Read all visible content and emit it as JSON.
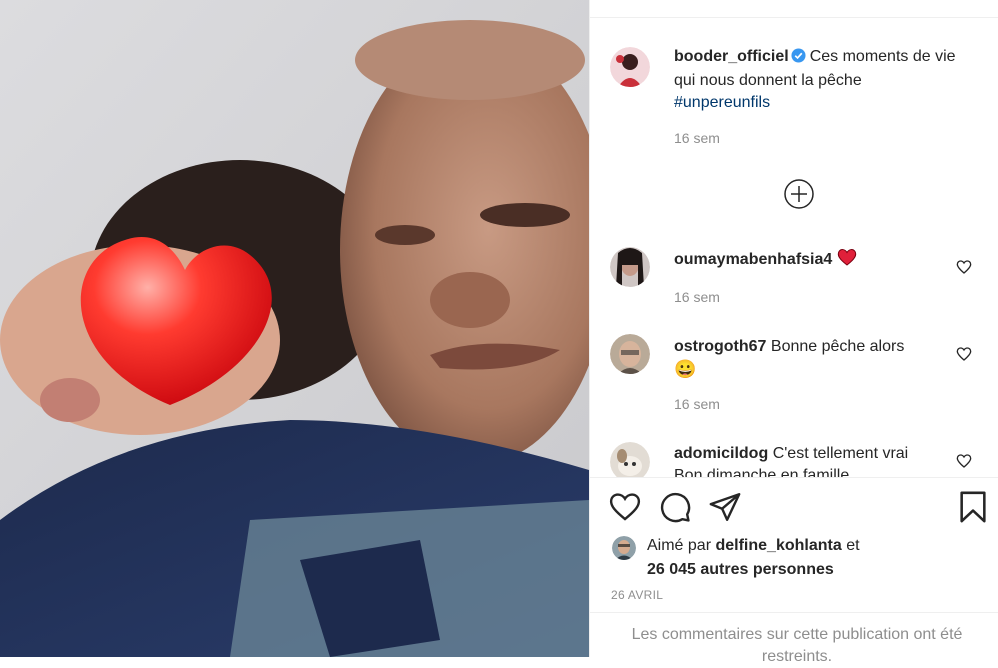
{
  "post": {
    "author": "booder_officiel",
    "caption": "Ces moments de vie qui nous donnent la pêche",
    "hashtag": "#unpereunfils",
    "time": "16 sem"
  },
  "comments": [
    {
      "user": "oumaymabenhafsia4",
      "text": "",
      "emoji": "heart",
      "time": "16 sem"
    },
    {
      "user": "ostrogoth67",
      "text": "Bonne pêche alors",
      "emoji": "😀",
      "time": "16 sem"
    },
    {
      "user": "adomicildog",
      "text": "C'est tellement vrai",
      "extra": "Bon dimanche en famille",
      "time": ""
    }
  ],
  "likes": {
    "prefix": "Aimé par",
    "user": "delfine_kohlanta",
    "conj": "et",
    "others": "26 045 autres personnes"
  },
  "date": "26 AVRIL",
  "restricted": "Les commentaires sur cette publication ont été restreints.",
  "colors": {
    "link": "#00376b",
    "muted": "#8e8e8e",
    "verified": "#3897f0",
    "heart": "#ed4956"
  }
}
